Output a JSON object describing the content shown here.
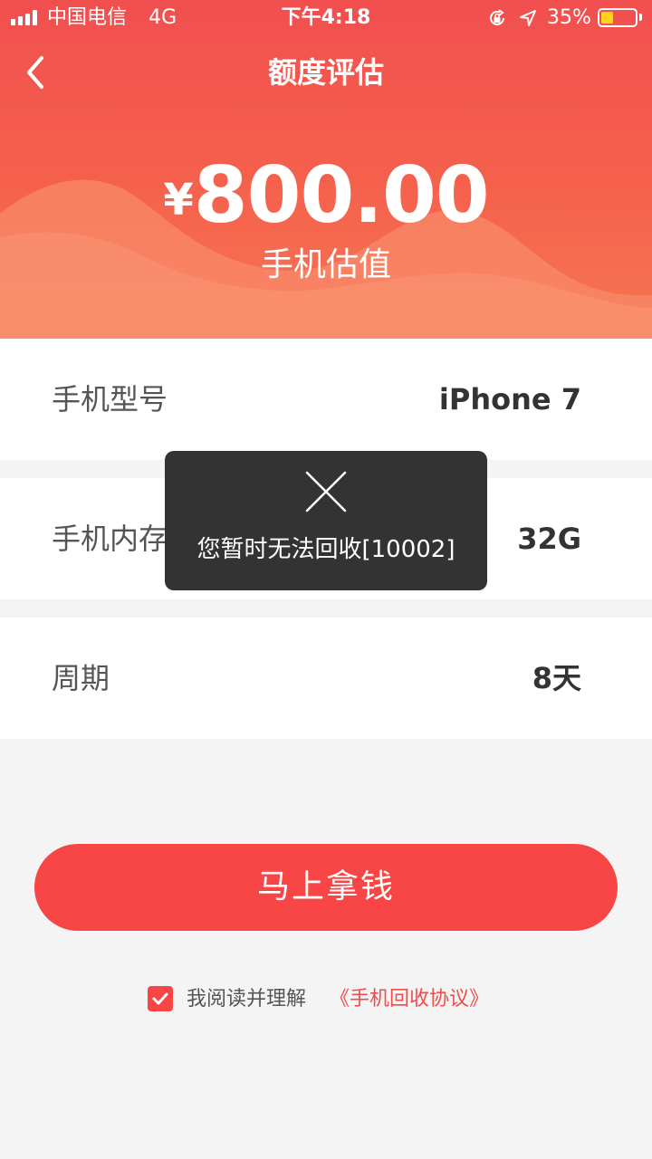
{
  "status_bar": {
    "carrier": "中国电信",
    "network": "4G",
    "time": "下午4:18",
    "battery": "35%",
    "battery_level": 0.35
  },
  "nav": {
    "back_icon": "chevron-left-icon",
    "title": "额度评估"
  },
  "valuation": {
    "currency": "¥",
    "amount": "800.00",
    "label": "手机估值"
  },
  "details": [
    {
      "label": "手机型号",
      "value": "iPhone 7"
    },
    {
      "label": "手机内存",
      "value": "32G"
    },
    {
      "label": "周期",
      "value": "8天"
    }
  ],
  "primary_button": "马上拿钱",
  "agreement": {
    "checked": true,
    "text": "我阅读并理解",
    "link": "《手机回收协议》"
  },
  "toast": {
    "icon": "close-icon",
    "message": "您暂时无法回收[10002]"
  },
  "colors": {
    "accent": "#f84545",
    "header_top": "#f14f4f",
    "header_bottom": "#f77652",
    "battery_fill": "#ffd21f"
  }
}
